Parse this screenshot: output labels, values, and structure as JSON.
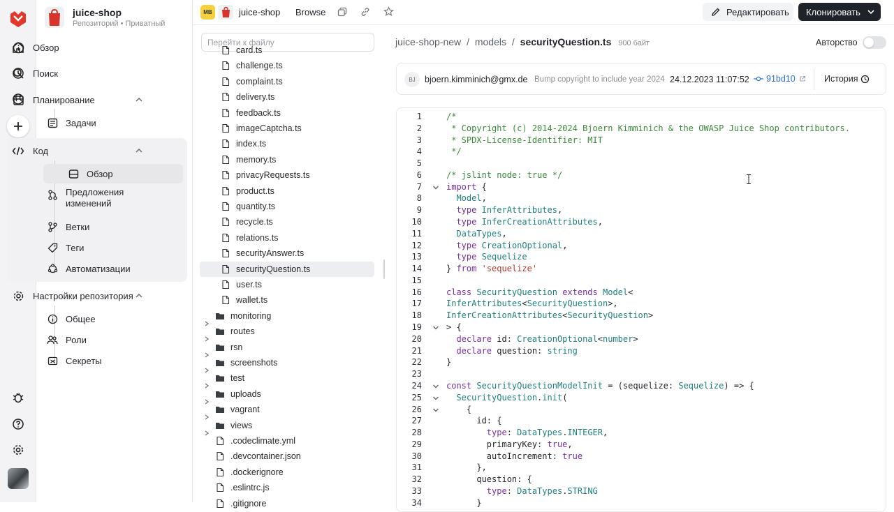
{
  "repo": {
    "name": "juice-shop",
    "subtitle": "Репозиторий • Приватный"
  },
  "nav": {
    "overview": "Обзор",
    "search": "Поиск",
    "planning": "Планирование",
    "tasks": "Задачи",
    "code": "Код",
    "code_overview": "Обзор",
    "pull_requests": "Предложения изменений",
    "branches": "Ветки",
    "tags": "Теги",
    "automations": "Автоматизации",
    "settings": "Настройки репозитория",
    "general": "Общее",
    "roles": "Роли",
    "secrets": "Секреты"
  },
  "topbar": {
    "badge": "MB",
    "repo": "juice-shop",
    "browse": "Browse",
    "edit": "Редактировать",
    "clone": "Клонировать"
  },
  "files": {
    "search_placeholder": "Перейти к файлу",
    "partial_top": "card.ts",
    "items": [
      "challenge.ts",
      "complaint.ts",
      "delivery.ts",
      "feedback.ts",
      "imageCaptcha.ts",
      "index.ts",
      "memory.ts",
      "privacyRequests.ts",
      "product.ts",
      "quantity.ts",
      "recycle.ts",
      "relations.ts",
      "securityAnswer.ts",
      "securityQuestion.ts",
      "user.ts",
      "wallet.ts"
    ],
    "folders": [
      "monitoring",
      "routes",
      "rsn",
      "screenshots",
      "test",
      "uploads",
      "vagrant",
      "views"
    ],
    "dotfiles": [
      ".codeclimate.yml",
      ".devcontainer.json",
      ".dockerignore",
      ".eslintrc.js"
    ],
    "partial_bottom": ".gitignore"
  },
  "breadcrumb": {
    "p1": "juice-shop-new",
    "sep": "/",
    "p2": "models",
    "file": "securityQuestion.ts",
    "size": "900 байт"
  },
  "authorship": "Авторство",
  "commit": {
    "avatar": "BJ",
    "author": "bjoern.kimminich@gmx.de",
    "message": "Bump copyright to include year 2024",
    "date": "24.12.2023 11:07:52",
    "hash": "91bd10",
    "history": "История"
  },
  "code_lines": [
    "/*",
    " * Copyright (c) 2014-2024 Bjoern Kimminich & the OWASP Juice Shop contributors.",
    " * SPDX-License-Identifier: MIT",
    " */",
    "",
    "/* jslint node: true */",
    "import {",
    "  Model,",
    "  type InferAttributes,",
    "  type InferCreationAttributes,",
    "  DataTypes,",
    "  type CreationOptional,",
    "  type Sequelize",
    "} from 'sequelize'",
    "",
    "class SecurityQuestion extends Model<",
    "InferAttributes<SecurityQuestion>,",
    "InferCreationAttributes<SecurityQuestion>",
    "> {",
    "  declare id: CreationOptional<number>",
    "  declare question: string",
    "}",
    "",
    "const SecurityQuestionModelInit = (sequelize: Sequelize) => {",
    "  SecurityQuestion.init(",
    "    {",
    "      id: {",
    "        type: DataTypes.INTEGER,",
    "        primaryKey: true,",
    "        autoIncrement: true",
    "      },",
    "      question: {",
    "        type: DataTypes.STRING",
    "      }"
  ],
  "colors": {
    "accent": "#2d6fd6",
    "comment": "#3a8a3a",
    "keyword": "#7a2ea0",
    "type": "#1f7f7f",
    "string": "#b03a2e",
    "dark_button": "#1e2229"
  }
}
